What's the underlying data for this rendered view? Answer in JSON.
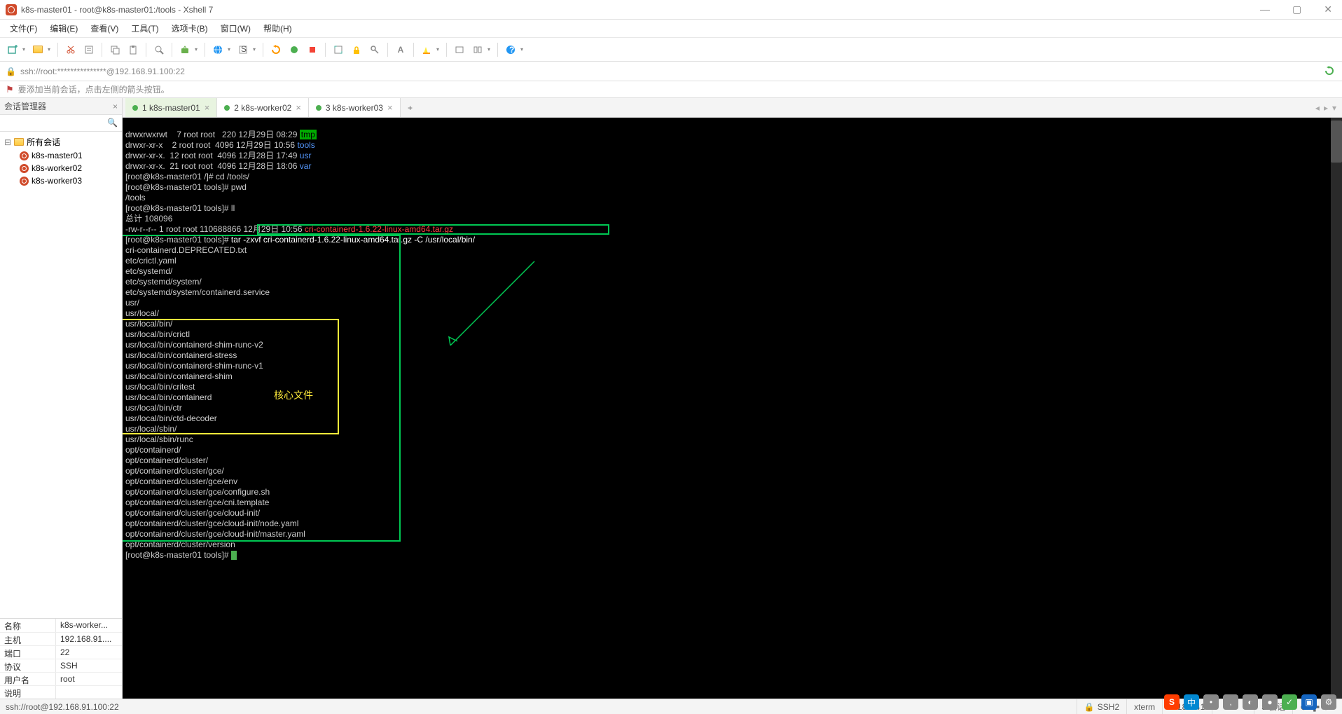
{
  "titlebar": {
    "text": "k8s-master01 - root@k8s-master01:/tools - Xshell 7"
  },
  "menubar": {
    "items": [
      "文件(F)",
      "编辑(E)",
      "查看(V)",
      "工具(T)",
      "选项卡(B)",
      "窗口(W)",
      "帮助(H)"
    ]
  },
  "addrbar": {
    "text": "ssh://root:***************@192.168.91.100:22"
  },
  "infostrip": {
    "text": "要添加当前会话，点击左侧的箭头按钮。"
  },
  "sidebar": {
    "title": "会话管理器",
    "root": "所有会话",
    "sessions": [
      "k8s-master01",
      "k8s-worker02",
      "k8s-worker03"
    ],
    "props": {
      "name_k": "名称",
      "name_v": "k8s-worker...",
      "host_k": "主机",
      "host_v": "192.168.91....",
      "port_k": "端口",
      "port_v": "22",
      "proto_k": "协议",
      "proto_v": "SSH",
      "user_k": "用户名",
      "user_v": "root",
      "desc_k": "说明",
      "desc_v": ""
    }
  },
  "tabs": {
    "t1": "1 k8s-master01",
    "t2": "2 k8s-worker02",
    "t3": "3 k8s-worker03"
  },
  "terminal": {
    "l1a": "drwxrwxrwt    7 root root   220 12月29日 08:29 ",
    "l1b": "tmp",
    "l2a": "drwxr-xr-x    2 root root  4096 12月29日 10:56 ",
    "l2b": "tools",
    "l3a": "drwxr-xr-x.  12 root root  4096 12月28日 17:49 ",
    "l3b": "usr",
    "l4a": "drwxr-xr-x.  21 root root  4096 12月28日 18:06 ",
    "l4b": "var",
    "l5": "[root@k8s-master01 /]# cd /tools/",
    "l6": "[root@k8s-master01 tools]# pwd",
    "l7": "/tools",
    "l8": "[root@k8s-master01 tools]# ll",
    "l9": "总计 108096",
    "l10a": "-rw-r--r-- 1 root root 110688866 12月29日 10:56 ",
    "l10b": "cri-containerd-1.6.22-linux-amd64.tar.gz",
    "l11a": "[root@k8s-master01 tools]# ",
    "l11b": "tar -zxvf cri-containerd-1.6.22-linux-amd64.tar.gz -C /usr/local/bin/",
    "l12": "cri-containerd.DEPRECATED.txt",
    "l13": "etc/crictl.yaml",
    "l14": "etc/systemd/",
    "l15": "etc/systemd/system/",
    "l16": "etc/systemd/system/containerd.service",
    "l17": "usr/",
    "l18": "usr/local/",
    "l19": "usr/local/bin/",
    "l20": "usr/local/bin/crictl",
    "l21": "usr/local/bin/containerd-shim-runc-v2",
    "l22": "usr/local/bin/containerd-stress",
    "l23": "usr/local/bin/containerd-shim-runc-v1",
    "l24": "usr/local/bin/containerd-shim",
    "l25": "usr/local/bin/critest",
    "l26": "usr/local/bin/containerd",
    "l27": "usr/local/bin/ctr",
    "l28": "usr/local/bin/ctd-decoder",
    "l29": "usr/local/sbin/",
    "l30": "usr/local/sbin/runc",
    "l31": "opt/containerd/",
    "l32": "opt/containerd/cluster/",
    "l33": "opt/containerd/cluster/gce/",
    "l34": "opt/containerd/cluster/gce/env",
    "l35": "opt/containerd/cluster/gce/configure.sh",
    "l36": "opt/containerd/cluster/gce/cni.template",
    "l37": "opt/containerd/cluster/gce/cloud-init/",
    "l38": "opt/containerd/cluster/gce/cloud-init/node.yaml",
    "l39": "opt/containerd/cluster/gce/cloud-init/master.yaml",
    "l40": "opt/containerd/cluster/version",
    "l41": "[root@k8s-master01 tools]# ",
    "core_label": "核心文件"
  },
  "statusbar": {
    "left": "ssh://root@192.168.91.100:22",
    "ssh": "SSH2",
    "term": "xterm",
    "size": "186x41",
    "rows_hint": "1,1",
    "sess": "3 会话"
  },
  "tray": {
    "s": "S",
    "ch": "中"
  }
}
